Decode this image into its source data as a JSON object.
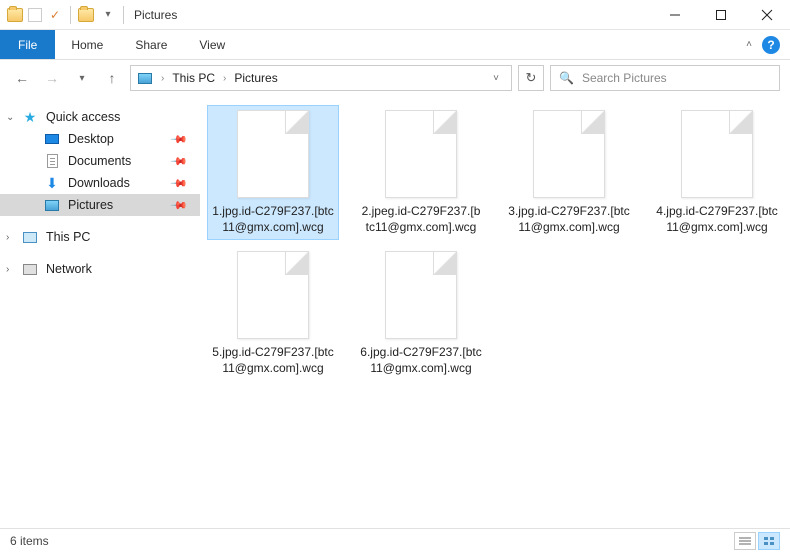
{
  "title": "Pictures",
  "ribbon": {
    "file": "File",
    "tabs": [
      "Home",
      "Share",
      "View"
    ]
  },
  "breadcrumb": {
    "items": [
      "This PC",
      "Pictures"
    ]
  },
  "search": {
    "placeholder": "Search Pictures"
  },
  "sidebar": {
    "quick_access": "Quick access",
    "items": [
      {
        "label": "Desktop"
      },
      {
        "label": "Documents"
      },
      {
        "label": "Downloads"
      },
      {
        "label": "Pictures"
      }
    ],
    "this_pc": "This PC",
    "network": "Network"
  },
  "files": [
    {
      "name": "1.jpg.id-C279F237.[btc11@gmx.com].wcg",
      "selected": true
    },
    {
      "name": "2.jpeg.id-C279F237.[btc11@gmx.com].wcg",
      "selected": false
    },
    {
      "name": "3.jpg.id-C279F237.[btc11@gmx.com].wcg",
      "selected": false
    },
    {
      "name": "4.jpg.id-C279F237.[btc11@gmx.com].wcg",
      "selected": false
    },
    {
      "name": "5.jpg.id-C279F237.[btc11@gmx.com].wcg",
      "selected": false
    },
    {
      "name": "6.jpg.id-C279F237.[btc11@gmx.com].wcg",
      "selected": false
    }
  ],
  "status": {
    "count": "6 items"
  }
}
